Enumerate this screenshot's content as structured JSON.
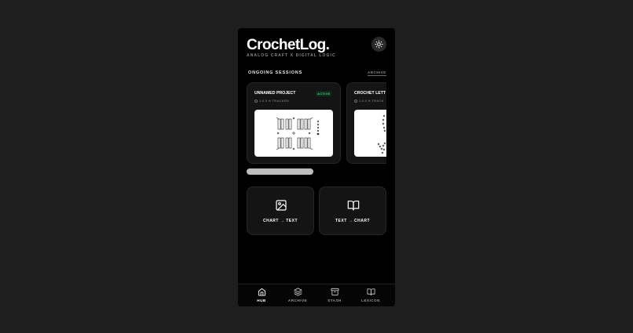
{
  "app": {
    "brand": "CrochetLog.",
    "tagline": "ANALOG CRAFT X DIGITAL LOGIC",
    "theme_icon": "sun-icon"
  },
  "sessions": {
    "title": "ONGOING SESSIONS",
    "archive_link": "ARCHIVE",
    "cards": [
      {
        "name": "UNNAMED PROJECT",
        "badge": "ACTIVE",
        "time": "1.0.0 H TRACKED",
        "thumbnail": "crochet-chart-grid"
      },
      {
        "name": "CROCHET LETT",
        "badge": "",
        "time": "1.0.0 H TRACK",
        "thumbnail": "crochet-chart-letters"
      }
    ]
  },
  "tools": [
    {
      "label": "CHART → TEXT",
      "icon": "image-icon"
    },
    {
      "label": "TEXT → CHART",
      "icon": "book-open-icon"
    }
  ],
  "nav": [
    {
      "label": "HUB",
      "icon": "home-icon",
      "active": true
    },
    {
      "label": "ARCHIVE",
      "icon": "layers-icon",
      "active": false
    },
    {
      "label": "STASH",
      "icon": "archive-box-icon",
      "active": false
    },
    {
      "label": "LEXICON",
      "icon": "book-open-icon",
      "active": false
    }
  ],
  "colors": {
    "background": "#1e1e1e",
    "phone": "#000000",
    "card": "#141414",
    "active_badge": "#38d078"
  }
}
